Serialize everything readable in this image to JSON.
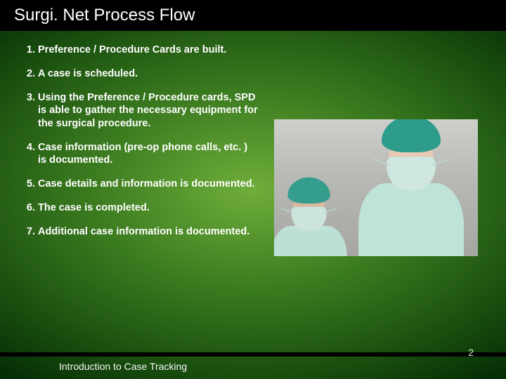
{
  "title": "Surgi. Net Process Flow",
  "steps": [
    "Preference / Procedure Cards are built.",
    "A case is scheduled.",
    "Using the Preference / Procedure cards, SPD is able to gather the necessary equipment for the surgical procedure.",
    "Case information (pre-op phone calls, etc. ) is documented.",
    "Case details and information is documented.",
    "The case is completed.",
    "Additional case information is documented."
  ],
  "image_alt": "Two surgical staff wearing teal caps and masks",
  "footer": {
    "caption": "Introduction to Case Tracking",
    "page_number": "2"
  }
}
